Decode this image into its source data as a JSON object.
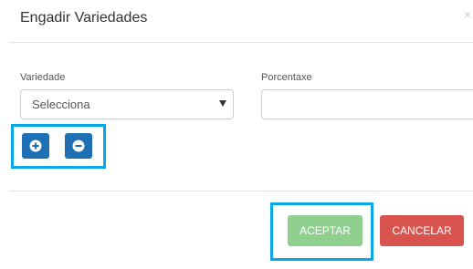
{
  "dialog": {
    "title": "Engadir Variedades",
    "close_symbol": "×"
  },
  "form": {
    "variedade": {
      "label": "Variedade",
      "selected_value": "Selecciona"
    },
    "porcentaxe": {
      "label": "Porcentaxe",
      "value": ""
    }
  },
  "icons": {
    "add": "plus-circle-icon",
    "remove": "minus-circle-icon"
  },
  "actions": {
    "accept_label": "ACEPTAR",
    "cancel_label": "CANCELAR"
  },
  "colors": {
    "primary_blue": "#1f6fb5",
    "highlight": "#0aa6e8",
    "accept_green": "#8fd08f",
    "cancel_red": "#d9534f"
  }
}
